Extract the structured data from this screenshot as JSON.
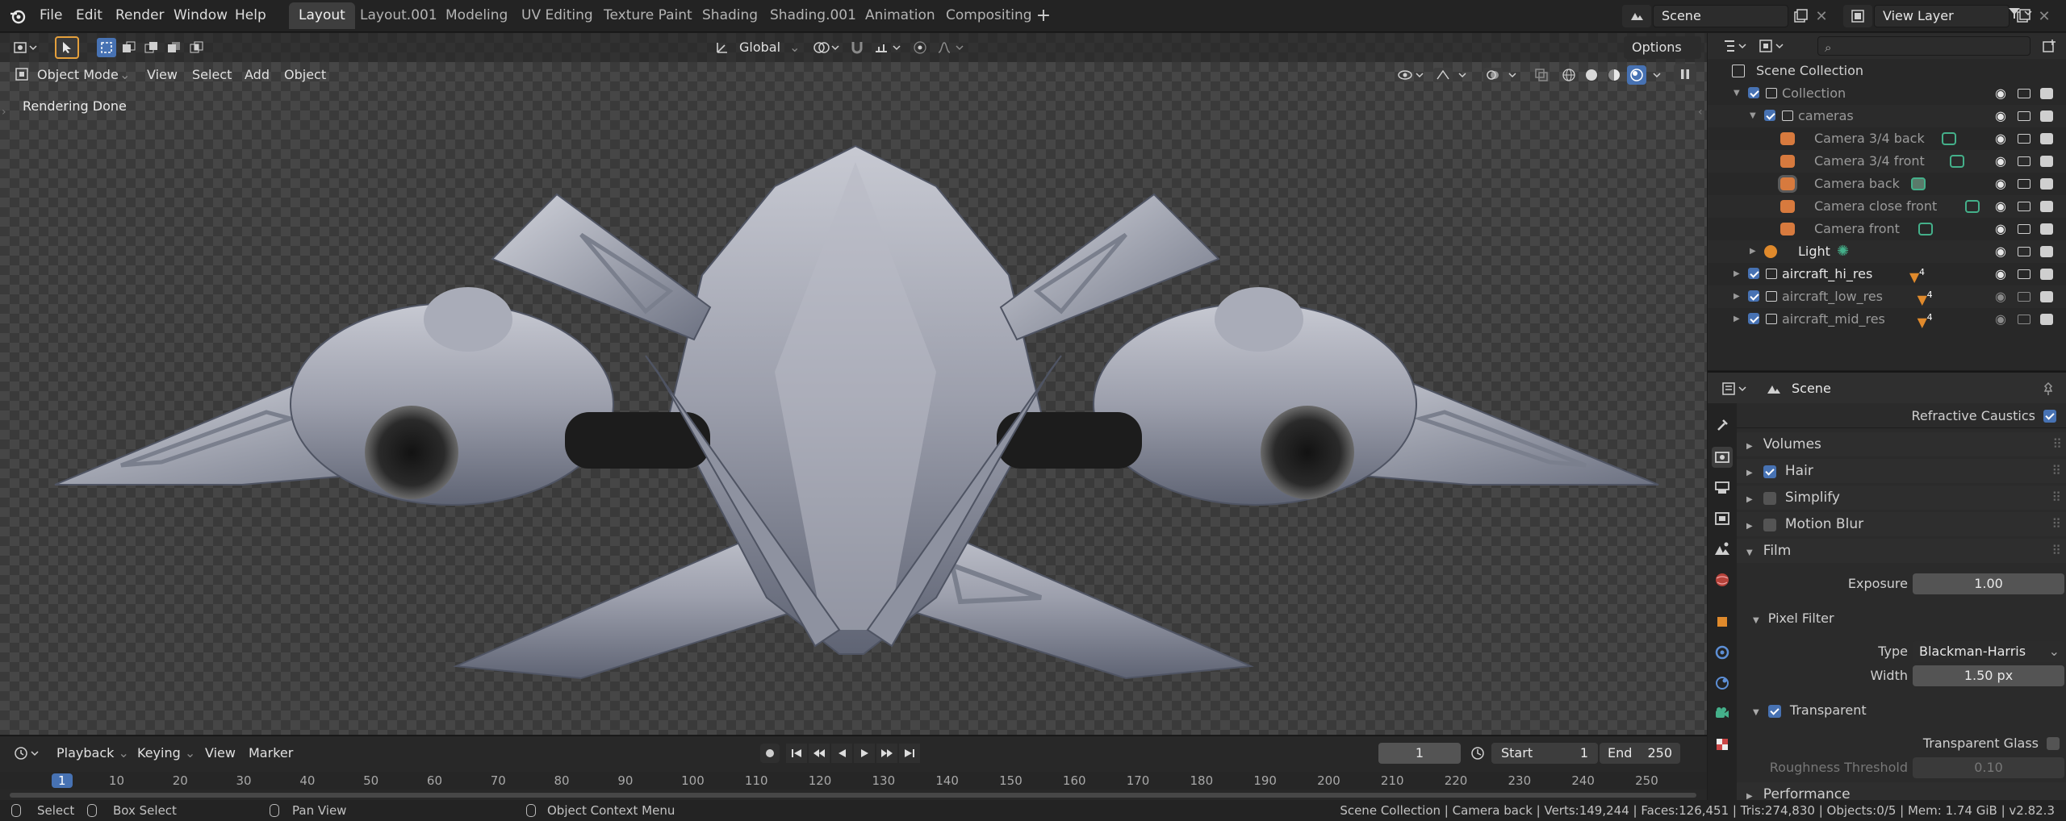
{
  "topbar": {
    "menus": [
      "File",
      "Edit",
      "Render",
      "Window",
      "Help"
    ],
    "workspace_tabs": [
      {
        "label": "Layout",
        "active": true
      },
      {
        "label": "Layout.001"
      },
      {
        "label": "Modeling"
      },
      {
        "label": "UV Editing"
      },
      {
        "label": "Texture Paint"
      },
      {
        "label": "Shading"
      },
      {
        "label": "Shading.001"
      },
      {
        "label": "Animation"
      },
      {
        "label": "Compositing"
      }
    ],
    "scene_name": "Scene",
    "view_layer": "View Layer"
  },
  "viewport": {
    "mode": "Object Mode",
    "menus": [
      "View",
      "Select",
      "Add",
      "Object"
    ],
    "transform_orientation": "Global",
    "options_label": "Options",
    "status_text": "Rendering Done"
  },
  "timeline": {
    "menus": [
      "Playback",
      "Keying",
      "View",
      "Marker"
    ],
    "current_frame": "1",
    "start_label": "Start",
    "start_value": "1",
    "end_label": "End",
    "end_value": "250",
    "ruler": [
      "1",
      "10",
      "20",
      "30",
      "40",
      "50",
      "60",
      "70",
      "80",
      "90",
      "100",
      "110",
      "120",
      "130",
      "140",
      "150",
      "160",
      "170",
      "180",
      "190",
      "200",
      "210",
      "220",
      "230",
      "240",
      "250"
    ]
  },
  "statusbar": {
    "select": "Select",
    "box_select": "Box Select",
    "pan_view": "Pan View",
    "context_menu": "Object Context Menu",
    "stats": "Scene Collection | Camera back | Verts:149,244 | Faces:126,451 | Tris:274,830 | Objects:0/5 | Mem: 1.74 GiB | v2.82.3"
  },
  "outliner": {
    "root": "Scene Collection",
    "rows": [
      {
        "label": "Collection",
        "badge": ""
      },
      {
        "label": "cameras",
        "badge": ""
      },
      {
        "label": "Camera 3/4 back",
        "badge": ""
      },
      {
        "label": "Camera 3/4 front",
        "badge": ""
      },
      {
        "label": "Camera back",
        "badge": ""
      },
      {
        "label": "Camera close front",
        "badge": ""
      },
      {
        "label": "Camera front",
        "badge": ""
      },
      {
        "label": "Light",
        "badge": ""
      },
      {
        "label": "aircraft_hi_res",
        "badge": "4"
      },
      {
        "label": "aircraft_low_res",
        "badge": "4"
      },
      {
        "label": "aircraft_mid_res",
        "badge": "4"
      }
    ]
  },
  "properties": {
    "context": "Scene",
    "refractive_caustics": "Refractive Caustics",
    "volumes": "Volumes",
    "hair": "Hair",
    "simplify": "Simplify",
    "motion_blur": "Motion Blur",
    "film": "Film",
    "exposure_label": "Exposure",
    "exposure_value": "1.00",
    "pixel_filter": "Pixel Filter",
    "type_label": "Type",
    "type_value": "Blackman-Harris",
    "width_label": "Width",
    "width_value": "1.50 px",
    "transparent": "Transparent",
    "transparent_glass": "Transparent Glass",
    "roughness_label": "Roughness Threshold",
    "roughness_value": "0.10",
    "performance": "Performance"
  },
  "colors": {
    "accent": "#4772b3",
    "camera_icon": "#d77a3e",
    "data_icon": "#44b08a"
  }
}
